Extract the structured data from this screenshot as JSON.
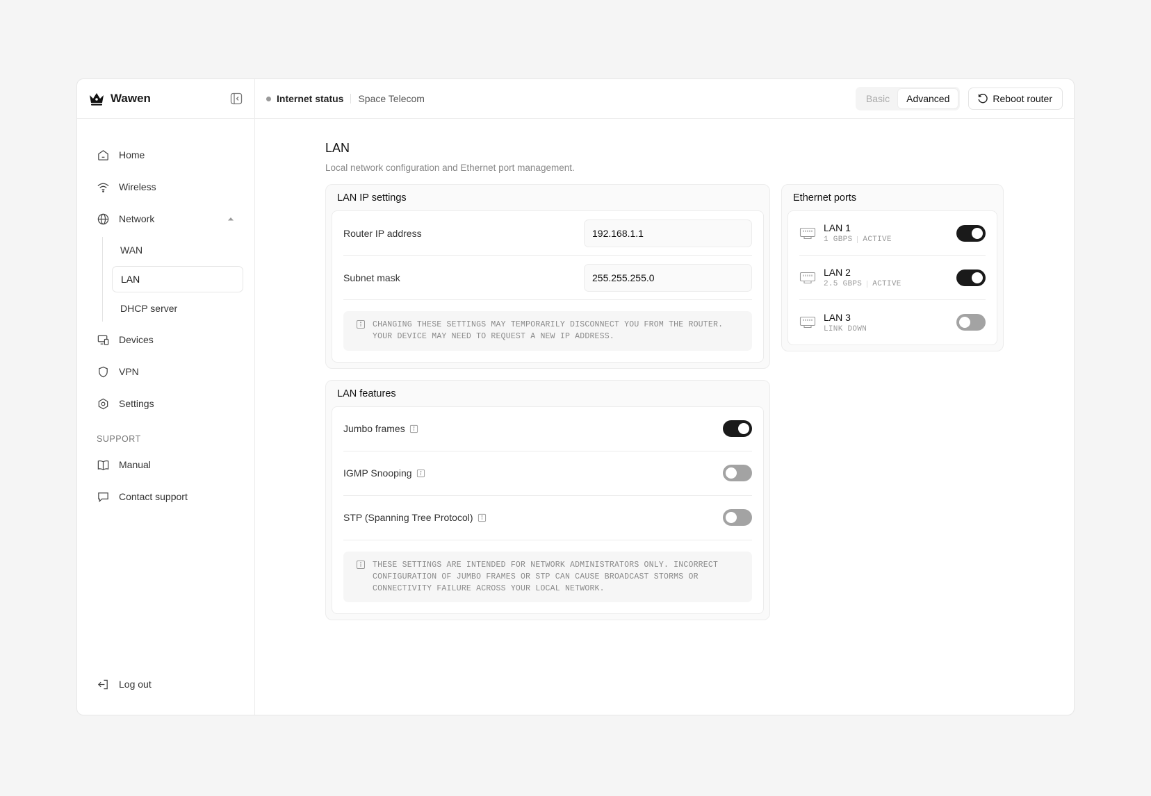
{
  "brand": {
    "name": "Wawen"
  },
  "sidebar": {
    "items": [
      {
        "label": "Home",
        "icon": "home-icon"
      },
      {
        "label": "Wireless",
        "icon": "wifi-icon"
      },
      {
        "label": "Network",
        "icon": "globe-icon",
        "expanded": true
      }
    ],
    "network_sub": [
      {
        "label": "WAN"
      },
      {
        "label": "LAN",
        "active": true
      },
      {
        "label": "DHCP server"
      }
    ],
    "items_after": [
      {
        "label": "Devices",
        "icon": "devices-icon"
      },
      {
        "label": "VPN",
        "icon": "shield-icon"
      },
      {
        "label": "Settings",
        "icon": "settings-icon"
      }
    ],
    "support_label": "SUPPORT",
    "support_items": [
      {
        "label": "Manual",
        "icon": "book-icon"
      },
      {
        "label": "Contact support",
        "icon": "chat-icon"
      }
    ],
    "logout_label": "Log out"
  },
  "topbar": {
    "status_label": "Internet status",
    "isp": "Space Telecom",
    "modes": [
      "Basic",
      "Advanced"
    ],
    "active_mode": "Advanced",
    "reboot_label": "Reboot router"
  },
  "page": {
    "title": "LAN",
    "subtitle": "Local network configuration and Ethernet port management."
  },
  "lan_ip": {
    "title": "LAN IP settings",
    "router_ip_label": "Router IP address",
    "router_ip_value": "192.168.1.1",
    "subnet_label": "Subnet mask",
    "subnet_value": "255.255.255.0",
    "notice": "CHANGING THESE SETTINGS MAY TEMPORARILY DISCONNECT YOU FROM THE ROUTER. YOUR DEVICE MAY NEED TO REQUEST A NEW IP ADDRESS."
  },
  "lan_features": {
    "title": "LAN features",
    "items": [
      {
        "label": "Jumbo frames",
        "enabled": true
      },
      {
        "label": "IGMP Snooping",
        "enabled": false
      },
      {
        "label": "STP (Spanning Tree Protocol)",
        "enabled": false
      }
    ],
    "notice": "THESE SETTINGS ARE INTENDED FOR NETWORK ADMINISTRATORS ONLY. INCORRECT CONFIGURATION OF JUMBO FRAMES OR STP CAN CAUSE BROADCAST STORMS OR CONNECTIVITY FAILURE ACROSS YOUR LOCAL NETWORK."
  },
  "ethernet": {
    "title": "Ethernet ports",
    "ports": [
      {
        "name": "LAN 1",
        "speed": "1 GBPS",
        "state": "ACTIVE",
        "enabled": true
      },
      {
        "name": "LAN 2",
        "speed": "2.5 GBPS",
        "state": "ACTIVE",
        "enabled": true
      },
      {
        "name": "LAN 3",
        "speed": "",
        "state": "LINK DOWN",
        "enabled": false
      }
    ]
  }
}
